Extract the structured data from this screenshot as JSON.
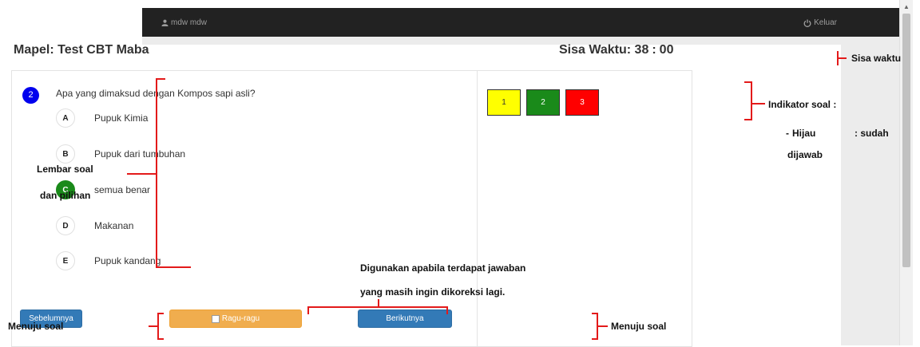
{
  "navbar": {
    "user_icon": "user-icon",
    "user_name": "mdw mdw",
    "logout_icon": "power-icon",
    "logout_label": "Keluar"
  },
  "header": {
    "subject": "Mapel: Test CBT Maba",
    "timer_label": "Sisa Waktu:",
    "timer_minutes": "38",
    "timer_separator": ":",
    "timer_seconds": "00"
  },
  "question": {
    "number": "2",
    "text": "Apa yang dimaksud dengan Kompos sapi  asli?",
    "options": [
      {
        "letter": "A",
        "text": "Pupuk Kimia",
        "selected": false
      },
      {
        "letter": "B",
        "text": "Pupuk dari tumbuhan",
        "selected": false
      },
      {
        "letter": "C",
        "text": "semua benar",
        "selected": true
      },
      {
        "letter": "D",
        "text": "Makanan",
        "selected": false
      },
      {
        "letter": "E",
        "text": "Pupuk kandang",
        "selected": false
      }
    ]
  },
  "buttons": {
    "prev": "Sebelumnya",
    "doubt": "Ragu-ragu",
    "next": "Berikutnya"
  },
  "indicators": [
    {
      "label": "1",
      "color": "#ffff00",
      "text_color": "#333333"
    },
    {
      "label": "2",
      "color": "#1a8a1a",
      "text_color": "#ffffff"
    },
    {
      "label": "3",
      "color": "#ff0000",
      "text_color": "#ffffff"
    }
  ],
  "annotations": {
    "sisa_waktu": "Sisa waktu",
    "indikator_title": "Indikator soal :",
    "hijau_dash": "-",
    "hijau_label": "Hijau",
    "hijau_value": ": sudah",
    "hijau_value2": "dijawab",
    "lembar_line1": "Lembar soal",
    "lembar_line2": "dan pilihan",
    "ragu_line1": "Digunakan apabila terdapat jawaban",
    "ragu_line2": "yang masih ingin dikoreksi lagi.",
    "menuju_left": "Menuju soal",
    "menuju_right": "Menuju soal"
  },
  "colors": {
    "navbar": "#222222",
    "primary": "#337ab7",
    "warning": "#f0ad4e",
    "question_number": "#0000ee",
    "selected_option": "#1a8a1a",
    "annotation_line": "#e31a1a"
  }
}
